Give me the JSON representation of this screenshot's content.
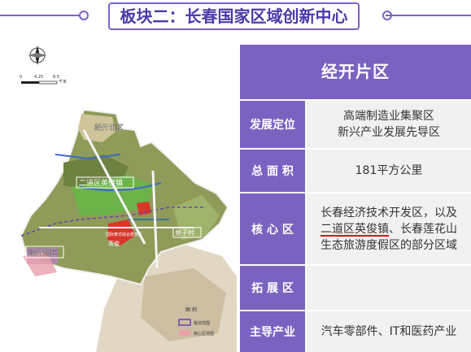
{
  "header": {
    "title": "板块二：长春国家区域创新中心"
  },
  "map": {
    "labels": {
      "north": "经开北区",
      "erdao": "二道区英俊镇",
      "south": "经开南区",
      "guoyuan": "国际奢式综合旅游区",
      "yingjun": "英俊",
      "quanzi": "泉子村"
    },
    "scale": {
      "zero": "0",
      "mid": "4.25",
      "end": "8.5",
      "unit": "千米"
    },
    "legend": {
      "title": "图 例",
      "item1": "板块范围",
      "item2": "核心区范围"
    }
  },
  "table": {
    "heading": "经开片区",
    "rows": {
      "positioning": {
        "label": "发展定位",
        "line1": "高端制造业集聚区",
        "line2": "新兴产业发展先导区"
      },
      "area": {
        "label": "总 面 积",
        "value": "181平方公里"
      },
      "core": {
        "label": "核 心 区",
        "line1": "长春经济技术开发区，以及",
        "line2_a": "二道区英俊镇",
        "line2_b": "、长春莲花山",
        "line3": "生态旅游度假区的部分区域"
      },
      "expand": {
        "label": "拓 展 区",
        "value": ""
      },
      "industry": {
        "label": "主导产业",
        "value": "汽车零部件、IT和医药产业"
      }
    }
  },
  "colors": {
    "accent": "#7a63c0",
    "header_text": "#4b39a8",
    "underline": "#e60012"
  }
}
